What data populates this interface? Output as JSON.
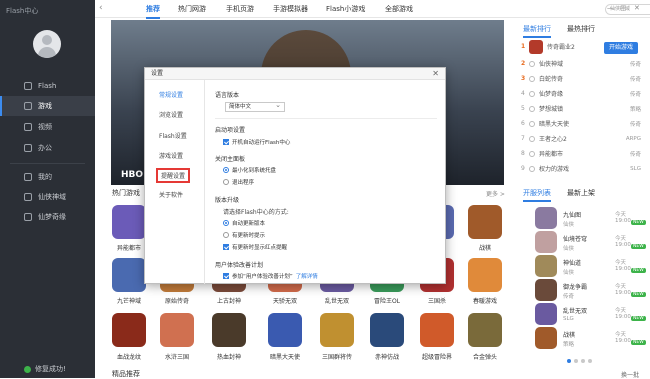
{
  "app": {
    "brand": "Flash中心"
  },
  "sidebar": {
    "items": [
      {
        "label": "Flash"
      },
      {
        "label": "游戏"
      },
      {
        "label": "视频"
      },
      {
        "label": "办公"
      },
      {
        "label": "我的"
      },
      {
        "label": "仙侠神域"
      },
      {
        "label": "仙梦奇缘"
      }
    ],
    "status": "修复成功!"
  },
  "topbar": {
    "tabs": [
      "推荐",
      "热门网游",
      "手机页游",
      "手游模拟器",
      "Flash小游戏",
      "全部游戏"
    ],
    "search_placeholder": "仙侠神域"
  },
  "banner": {
    "text": "HBO"
  },
  "hot_games": {
    "title": "热门游戏",
    "more": "更多 >",
    "row1": [
      "异能都市",
      "",
      "",
      "",
      "",
      "",
      "",
      "战棋"
    ],
    "row2": [
      "九芒神域",
      "原始传奇",
      "上古封神",
      "天骄无双",
      "乱世无双",
      "冒险王OL",
      "三国杀",
      "春暖游戏"
    ],
    "row3": [
      "血战龙纹",
      "水浒三国",
      "热血封神",
      "暗黑大天使",
      "三国群将传",
      "赤神仿战",
      "超级冒险界",
      "合金弹头"
    ]
  },
  "bottom_section": "精品推荐",
  "rank": {
    "tabs": [
      "最新排行",
      "最热排行"
    ],
    "start_button": "开始游戏",
    "items": [
      {
        "num": "1",
        "name": "传奇霸业2",
        "type": ""
      },
      {
        "num": "2",
        "name": "仙侠神域",
        "type": "传奇"
      },
      {
        "num": "3",
        "name": "白蛇传奇",
        "type": "传奇"
      },
      {
        "num": "4",
        "name": "仙梦奇缘",
        "type": "传奇"
      },
      {
        "num": "5",
        "name": "梦想城镇",
        "type": "策略"
      },
      {
        "num": "6",
        "name": "暗黑大天使",
        "type": "传奇"
      },
      {
        "num": "7",
        "name": "王者之心2",
        "type": "ARPG"
      },
      {
        "num": "8",
        "name": "异能都市",
        "type": "传奇"
      },
      {
        "num": "9",
        "name": "权力的游戏",
        "type": "SLG"
      }
    ]
  },
  "open_servers": {
    "tabs": [
      "开服列表",
      "最新上架"
    ],
    "new_badge": "NEW",
    "items": [
      {
        "name": "九仙图",
        "type": "仙侠",
        "time": "今天 19:00"
      },
      {
        "name": "仙境苍穹",
        "type": "仙侠",
        "time": "今天 19:00"
      },
      {
        "name": "神仙道",
        "type": "仙侠",
        "time": "今天 19:00"
      },
      {
        "name": "御龙争霸",
        "type": "传奇",
        "time": "今天 19:00"
      },
      {
        "name": "乱世无双",
        "type": "SLG",
        "time": "今天 19:00"
      },
      {
        "name": "战棋",
        "type": "策略",
        "time": "今天 19:00"
      }
    ],
    "refresh": "换一批"
  },
  "settings_dialog": {
    "title": "设置",
    "menu": [
      "常规设置",
      "浏览设置",
      "Flash设置",
      "游戏设置",
      "提醒设置",
      "关于软件"
    ],
    "language_label": "语言版本",
    "language_value": "简体中文",
    "startup_label": "启动项设置",
    "startup_option": "开机自动运行Flash中心",
    "close_label": "关闭主面板",
    "close_options": [
      "最小化到系统托盘",
      "退出程序"
    ],
    "update_label": "版本升级",
    "update_question": "请选择Flash中心的方式:",
    "update_options": [
      "自动更新版本",
      "有更新时提示",
      "有更新时显示红点提醒"
    ],
    "ux_label": "用户体验改善计划",
    "ux_option": "参加“用户体验改善计划”",
    "ux_link": "了解详情"
  }
}
